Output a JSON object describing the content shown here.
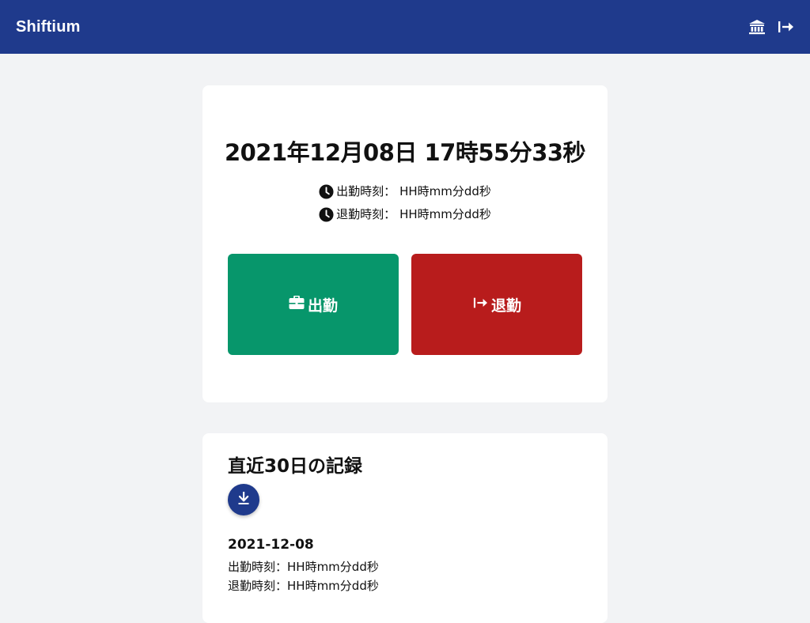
{
  "header": {
    "brand": "Shiftium",
    "icons": [
      "bank-icon",
      "sign-out-icon"
    ],
    "color": "#1f3a8c"
  },
  "clock": {
    "datetime": "2021年12月08日 17時55分33秒",
    "clock_in_label": "出勤時刻：",
    "clock_in_value": "HH時mm分dd秒",
    "clock_out_label": "退勤時刻：",
    "clock_out_value": "HH時mm分dd秒"
  },
  "actions": {
    "clock_in_label": "出勤",
    "clock_in_color": "#07966b",
    "clock_out_label": "退勤",
    "clock_out_color": "#b81c1c"
  },
  "records": {
    "title": "直近30日の記録",
    "download_icon": "download-icon",
    "items": [
      {
        "date": "2021-12-08",
        "clock_in_label": "出勤時刻：",
        "clock_in_value": "HH時mm分dd秒",
        "clock_out_label": "退勤時刻：",
        "clock_out_value": "HH時mm分dd秒"
      }
    ]
  }
}
